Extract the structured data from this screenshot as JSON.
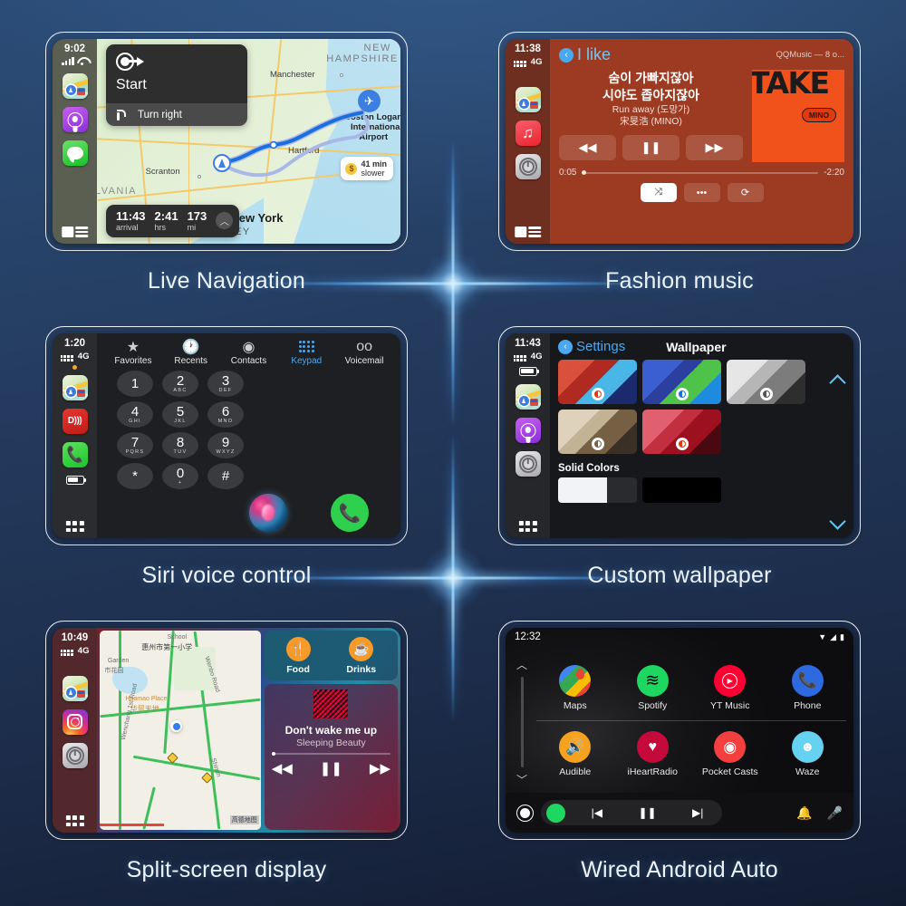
{
  "theme": {
    "bg_top": "#2a4a74",
    "bg_bottom": "#121c31",
    "flare": "#bfe9ff",
    "accent_blue": "#4aa8f0"
  },
  "panels": [
    {
      "caption": "Live Navigation",
      "status": {
        "time": "9:02",
        "signal": "signal-bars",
        "wifi": "wifi-icon"
      },
      "sidebar_apps": [
        "maps-icon",
        "podcasts-icon",
        "messages-icon"
      ],
      "direction_card": {
        "maneuver": "start-arrow-icon",
        "primary": "Start",
        "next_icon": "turn-right-icon",
        "next": "Turn right"
      },
      "eta": [
        {
          "value": "11:43",
          "label": "arrival"
        },
        {
          "value": "2:41",
          "label": "hrs"
        },
        {
          "value": "173",
          "label": "mi"
        }
      ],
      "map_labels": {
        "state_top": "NEW",
        "state_top2": "HAMPSHIRE",
        "manchester": "Manchester",
        "airport_l1": "Boston Logan",
        "airport_l2": "International",
        "airport_l3": "Airport",
        "hartford": "Hartford",
        "scranton": "Scranton",
        "pennsylvania": "LVANIA",
        "newyork": "New York",
        "jersey": "RSEY"
      },
      "slower_chip": {
        "badge": "$",
        "line1": "41 min",
        "line2": "slower"
      }
    },
    {
      "caption": "Fashion music",
      "status": {
        "time": "11:38",
        "network": "4G"
      },
      "sidebar_apps": [
        "maps-icon",
        "music-icon",
        "settings-icon"
      ],
      "header": {
        "back_label": "I like",
        "source": "QQMusic — 8 o..."
      },
      "lyrics": [
        "숨이 가빠지잖아",
        "시야도 좁아지잖아"
      ],
      "track": "Run away (도망가)",
      "artist": "宋旻浩 (MINO)",
      "album_art": {
        "title": "TAKE",
        "badge": "MINO"
      },
      "controls": [
        "rewind-icon",
        "pause-icon",
        "fast-forward-icon"
      ],
      "progress": {
        "elapsed": "0:05",
        "remaining": "-2:20",
        "percent": 3
      },
      "secondary": [
        "shuffle-icon",
        "more-icon",
        "repeat-icon"
      ]
    },
    {
      "caption": "Siri voice control",
      "status": {
        "time": "1:20",
        "network": "4G"
      },
      "sidebar_apps": [
        "maps-icon",
        "dab-radio-icon",
        "phone-icon"
      ],
      "tabs": [
        {
          "label": "Favorites",
          "icon": "star-icon",
          "active": false
        },
        {
          "label": "Recents",
          "icon": "clock-icon",
          "active": false
        },
        {
          "label": "Contacts",
          "icon": "person-icon",
          "active": false
        },
        {
          "label": "Keypad",
          "icon": "keypad-icon",
          "active": true
        },
        {
          "label": "Voicemail",
          "icon": "voicemail-icon",
          "active": false
        }
      ],
      "keys": [
        {
          "digit": "1",
          "sub": ""
        },
        {
          "digit": "2",
          "sub": "ABC"
        },
        {
          "digit": "3",
          "sub": "DEF"
        },
        {
          "digit": "4",
          "sub": "GHI"
        },
        {
          "digit": "5",
          "sub": "JKL"
        },
        {
          "digit": "6",
          "sub": "MNO"
        },
        {
          "digit": "7",
          "sub": "PQRS"
        },
        {
          "digit": "8",
          "sub": "TUV"
        },
        {
          "digit": "9",
          "sub": "WXYZ"
        },
        {
          "digit": "*",
          "sub": ""
        },
        {
          "digit": "0",
          "sub": "+"
        },
        {
          "digit": "#",
          "sub": ""
        }
      ],
      "siri_orb": "siri-orb",
      "call_button": "call-icon"
    },
    {
      "caption": "Custom wallpaper",
      "status": {
        "time": "11:43",
        "network": "4G"
      },
      "sidebar_apps": [
        "maps-icon",
        "podcasts-icon",
        "settings-icon"
      ],
      "header": {
        "back_label": "Settings",
        "title": "Wallpaper"
      },
      "thumbs": [
        {
          "name": "red-blue-wallpaper",
          "c1": "#d9503c",
          "c2": "#8b1520",
          "c3": "#49b6e8",
          "c4": "#1a2a6c"
        },
        {
          "name": "blue-green-wallpaper",
          "c1": "#3b5fd0",
          "c2": "#2a3f9e",
          "c3": "#4fc24a",
          "c4": "#1e8be0"
        },
        {
          "name": "gray-wallpaper",
          "c1": "#e3e3e3",
          "c2": "#9a9a9a",
          "c3": "#6b6b6b",
          "c4": "#2b2b2b"
        },
        {
          "name": "beige-wallpaper",
          "c1": "#ded2bd",
          "c2": "#b8a88d",
          "c3": "#6b5a42",
          "c4": "#3a3025"
        },
        {
          "name": "red-wallpaper",
          "c1": "#e06070",
          "c2": "#b02030",
          "c3": "#8c101e",
          "c4": "#4a0810"
        }
      ],
      "solid_label": "Solid Colors",
      "solids": [
        "#f2f3f7",
        "#000000"
      ],
      "scroll": {
        "up": "chevron-up-icon",
        "down": "chevron-down-icon"
      }
    },
    {
      "caption": "Split-screen display",
      "status": {
        "time": "10:49",
        "network": "4G"
      },
      "sidebar_apps": [
        "maps-icon",
        "instagram-icon",
        "settings-icon"
      ],
      "map_labels": {
        "school_en": "School",
        "school_cn": "惠州市第一小学",
        "garden_en": "Garden",
        "garden_cn": "市花园",
        "place_en": "Huamao Place",
        "place_cn": "华贸天地",
        "road1": "Wenchang 1st Road",
        "road2": "Wenbo Road",
        "road3": "Shimin",
        "credit": "高德地图"
      },
      "quick": [
        {
          "label": "Food",
          "icon": "food-icon"
        },
        {
          "label": "Drinks",
          "icon": "drinks-icon"
        }
      ],
      "music": {
        "title": "Don't wake me up",
        "artist": "Sleeping Beauty",
        "controls": [
          "rewind-icon",
          "pause-icon",
          "fast-forward-icon"
        ]
      }
    },
    {
      "caption": "Wired Android Auto",
      "status": {
        "time": "12:32",
        "icons": [
          "wifi-icon",
          "signal-icon",
          "battery-icon"
        ]
      },
      "apps": [
        {
          "label": "Maps",
          "icon": "google-maps-icon",
          "color": "#ffffff"
        },
        {
          "label": "Spotify",
          "icon": "spotify-icon",
          "color": "#1ed760"
        },
        {
          "label": "YT Music",
          "icon": "youtube-music-icon",
          "color": "#ff0033"
        },
        {
          "label": "Phone",
          "icon": "phone-icon",
          "color": "#2d6ae0"
        },
        {
          "label": "Audible",
          "icon": "audible-icon",
          "color": "#f5a21e"
        },
        {
          "label": "iHeartRadio",
          "icon": "iheartradio-icon",
          "color": "#c6093b"
        },
        {
          "label": "Pocket Casts",
          "icon": "pocket-casts-icon",
          "color": "#f43f3f"
        },
        {
          "label": "Waze",
          "icon": "waze-icon",
          "color": "#64d2f0"
        }
      ],
      "bottom_bar": {
        "home": "home-icon",
        "media_app": "spotify-icon",
        "prev": "previous-icon",
        "play": "pause-icon",
        "next": "next-icon",
        "notifications": "bell-icon",
        "assistant": "mic-icon"
      },
      "scroll": {
        "up": "chevron-up-icon",
        "down": "chevron-down-icon"
      }
    }
  ]
}
